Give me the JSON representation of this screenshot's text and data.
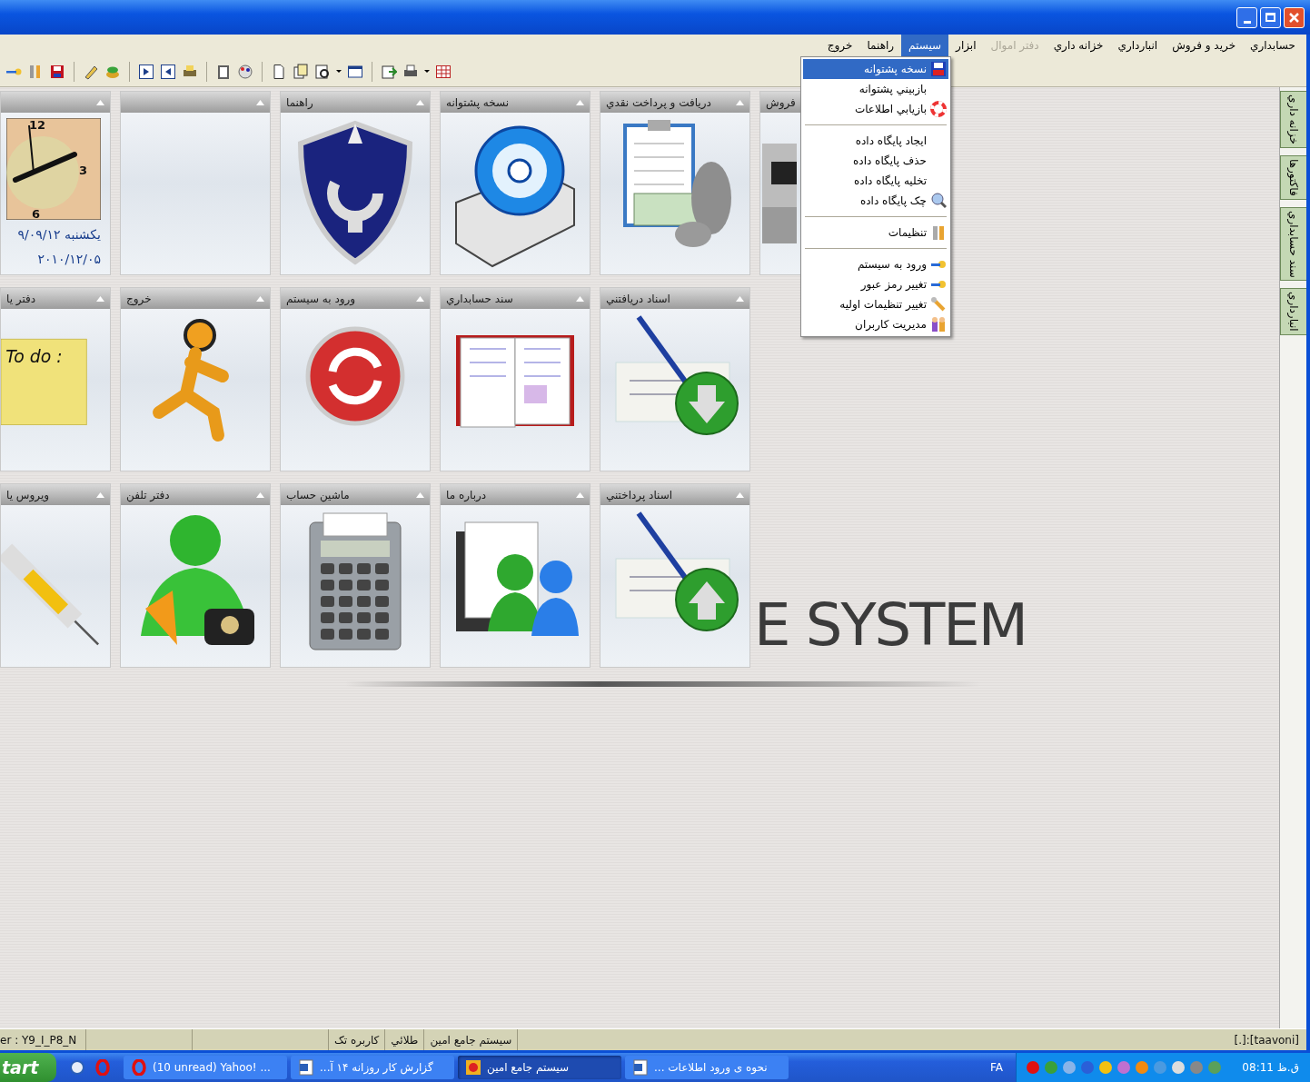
{
  "menu_bar": [
    {
      "label": "حسابداري",
      "selected": false,
      "disabled": false
    },
    {
      "label": "خريد و فروش",
      "selected": false,
      "disabled": false
    },
    {
      "label": "انبارداري",
      "selected": false,
      "disabled": false
    },
    {
      "label": "خزانه داري",
      "selected": false,
      "disabled": false
    },
    {
      "label": "دفتر اموال",
      "selected": false,
      "disabled": true
    },
    {
      "label": "ابزار",
      "selected": false,
      "disabled": false
    },
    {
      "label": "سيستم",
      "selected": true,
      "disabled": false
    },
    {
      "label": "راهنما",
      "selected": false,
      "disabled": false
    },
    {
      "label": "خروج",
      "selected": false,
      "disabled": false
    }
  ],
  "system_menu": [
    {
      "kind": "item",
      "label": "نسخه پشتوانه",
      "selected": true
    },
    {
      "kind": "item",
      "label": "بازبيني پشتوانه",
      "selected": false
    },
    {
      "kind": "item",
      "label": "بازيابي اطلاعات",
      "selected": false
    },
    {
      "kind": "separator"
    },
    {
      "kind": "item",
      "label": "ايجاد پايگاه داده",
      "selected": false
    },
    {
      "kind": "item",
      "label": "حذف پايگاه داده",
      "selected": false
    },
    {
      "kind": "item",
      "label": "تخليه پايگاه داده",
      "selected": false
    },
    {
      "kind": "item",
      "label": "چک  پايگاه داده",
      "selected": false
    },
    {
      "kind": "separator"
    },
    {
      "kind": "item",
      "label": "تنظيمات",
      "selected": false
    },
    {
      "kind": "separator"
    },
    {
      "kind": "item",
      "label": "ورود به سيستم",
      "selected": false
    },
    {
      "kind": "item",
      "label": "تغيير رمز عبور",
      "selected": false
    },
    {
      "kind": "item",
      "label": "تغيير تنظيمات اوليه",
      "selected": false
    },
    {
      "kind": "item",
      "label": "مديريت كاربران",
      "selected": false
    }
  ],
  "tiles": [
    [
      {
        "kind": "register",
        "title": "فروش"
      },
      {
        "kind": "money",
        "title": "دريافت و پرداخت نقدي"
      },
      {
        "kind": "disc",
        "title": "نسخه پشتوانه"
      },
      {
        "kind": "shield",
        "title": "راهنما"
      },
      {
        "kind": "blank"
      },
      {
        "kind": "clock",
        "clock_numbers": [
          "12",
          "3",
          "6"
        ],
        "weekday_date": "يكشنبه ۹/۰۹/۱۲",
        "gregorian_date": "۲۰۱۰/۱۲/۰۵"
      }
    ],
    [
      {
        "kind": "cheque_down",
        "title": "اسناد دريافتني"
      },
      {
        "kind": "book",
        "title": "سند حسابداري"
      },
      {
        "kind": "refresh",
        "title": "ورود به سيستم"
      },
      {
        "kind": "runner",
        "title": "خروج"
      },
      {
        "kind": "note",
        "title": "دفتر يا",
        "note_text": "To do :"
      }
    ],
    [
      {
        "kind": "cheque_up",
        "title": "اسناد پرداختني"
      },
      {
        "kind": "people",
        "title": "درباره ما"
      },
      {
        "kind": "calculator",
        "title": "ماشين حساب"
      },
      {
        "kind": "contacts",
        "title": "دفتر تلفن"
      },
      {
        "kind": "syringe",
        "title": "ويروس يا"
      }
    ]
  ],
  "background_logo": {
    "text": "E SYSTEM"
  },
  "side_tabs": [
    "خزانه داري",
    "فاكتورها",
    "سند حسابداري",
    "انبارداري"
  ],
  "status_bar": {
    "version": "er : Y9_I_P8_N",
    "panels": [
      "سيستم جامع امين",
      "طلائي",
      "كاربره تک"
    ],
    "database": "[.]:[taavoni]"
  },
  "taskbar": {
    "start": "tart",
    "tasks": [
      {
        "label": "نحوه ی ورود اطلاعات ...",
        "selected": false
      },
      {
        "label": "سيستم جامع امين",
        "selected": true
      },
      {
        "label": "گزارش كار روزانه ۱۴ آ...",
        "selected": false
      },
      {
        "label": "(10 unread) Yahoo! ...",
        "selected": false
      }
    ],
    "language": "FA",
    "clock": "ق.ظ 08:11"
  }
}
